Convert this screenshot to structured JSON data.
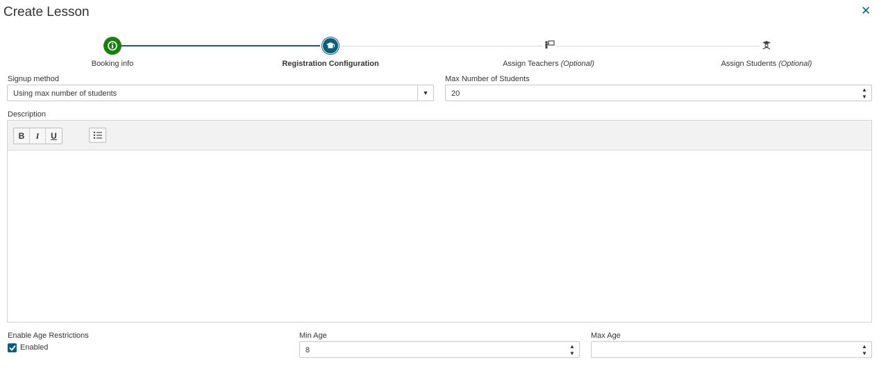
{
  "dialog": {
    "title": "Create Lesson",
    "close_glyph": "✕"
  },
  "colors": {
    "accent": "#0b5e79",
    "success": "#1e7d12",
    "line_inactive": "#d9d9d9"
  },
  "stepper": {
    "steps": [
      {
        "label": "Booking info",
        "optional": "",
        "state": "completed",
        "icon": "info-icon"
      },
      {
        "label": "Registration Configuration",
        "optional": "",
        "state": "active",
        "icon": "graduation-cap-icon"
      },
      {
        "label": "Assign Teachers ",
        "optional": "(Optional)",
        "state": "pending",
        "icon": "teacher-icon"
      },
      {
        "label": "Assign Students ",
        "optional": "(Optional)",
        "state": "pending",
        "icon": "student-icon"
      }
    ]
  },
  "form": {
    "signup_method": {
      "label": "Signup method",
      "value": "Using max number of students",
      "dropdown_glyph": "▼"
    },
    "max_students": {
      "label": "Max Number of Students",
      "value": "20"
    },
    "description": {
      "label": "Description",
      "toolbar": {
        "bold": "B",
        "italic": "I",
        "underline": "U"
      },
      "value": ""
    },
    "age_restrictions": {
      "label": "Enable Age Restrictions",
      "checkbox_label": "Enabled",
      "checked": true
    },
    "min_age": {
      "label": "Min Age",
      "value": "8"
    },
    "max_age": {
      "label": "Max Age",
      "value": ""
    }
  },
  "spinner": {
    "up": "▲",
    "down": "▼"
  }
}
